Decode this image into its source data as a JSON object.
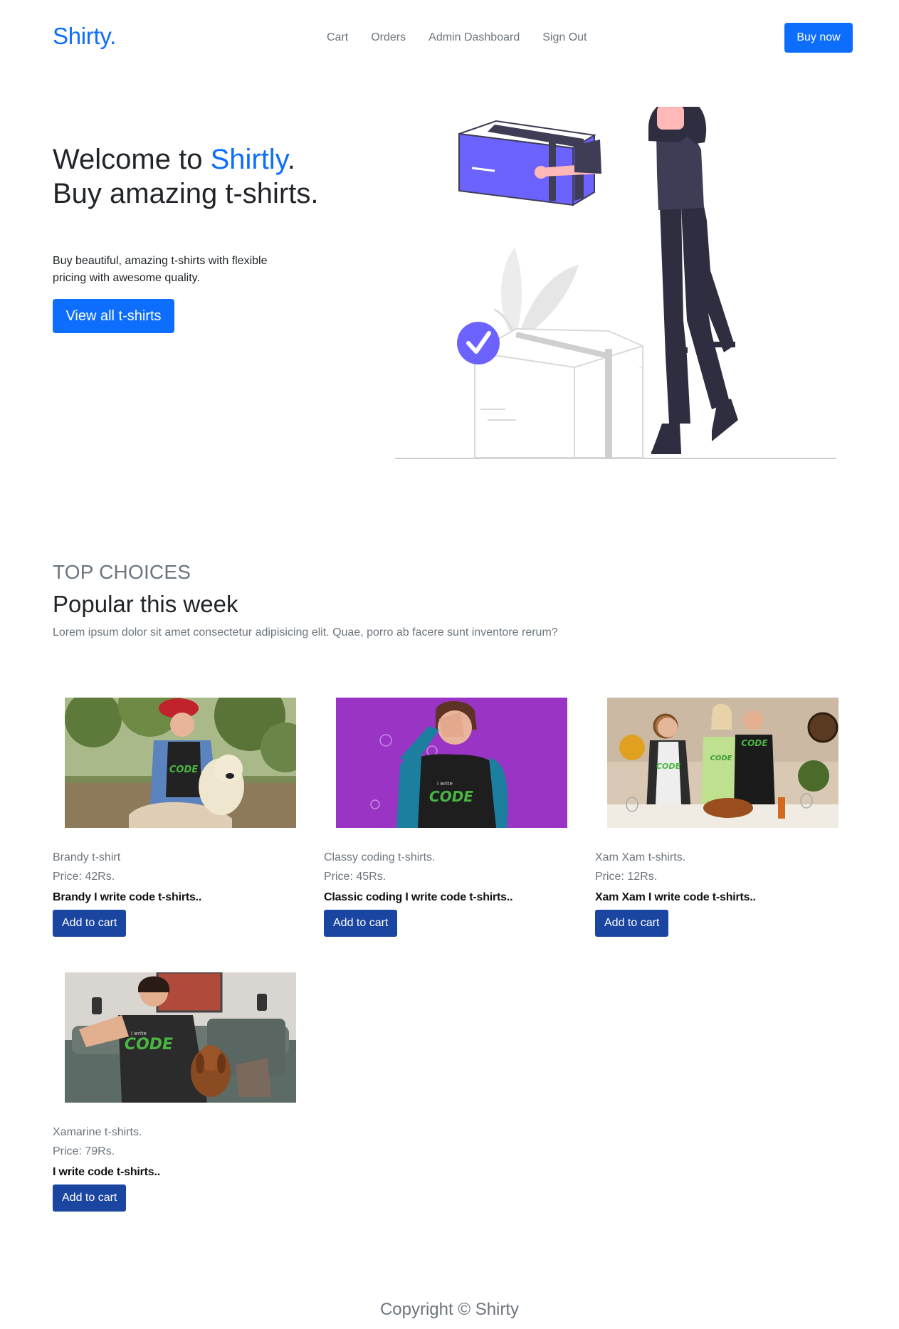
{
  "nav": {
    "brand": "Shirty.",
    "links": [
      "Cart",
      "Orders",
      "Admin Dashboard",
      "Sign Out"
    ],
    "cta": "Buy now"
  },
  "hero": {
    "title_prefix": "Welcome to ",
    "title_accent": "Shirtly",
    "title_suffix": ".",
    "title_line2": "Buy amazing t-shirts.",
    "description": "Buy beautiful, amazing t-shirts with flexible pricing with awesome quality.",
    "button": "View all t-shirts"
  },
  "section": {
    "eyebrow": "TOP CHOICES",
    "title": "Popular this week",
    "description": "Lorem ipsum dolor sit amet consectetur adipisicing elit. Quae, porro ab facere sunt inventore rerum?"
  },
  "products": [
    {
      "name": "Brandy t-shirt",
      "price": "Price: 42Rs.",
      "tagline": "Brandy I write code t-shirts..",
      "button": "Add to cart",
      "image": "woman-with-dog-photo"
    },
    {
      "name": "Classy coding t-shirts.",
      "price": "Price: 45Rs.",
      "tagline": "Classic coding I write code t-shirts..",
      "button": "Add to cart",
      "image": "woman-purple-background-photo"
    },
    {
      "name": "Xam Xam t-shirts.",
      "price": "Price: 12Rs.",
      "tagline": "Xam Xam I write code t-shirts..",
      "button": "Add to cart",
      "image": "family-dinner-photo"
    },
    {
      "name": "Xamarine t-shirts.",
      "price": "Price: 79Rs.",
      "tagline": "I write code t-shirts..",
      "button": "Add to cart",
      "image": "man-with-dog-photo"
    }
  ],
  "shirt_print": "CODE",
  "shirt_print_small": "I write",
  "footer": "Copyright © Shirty",
  "colors": {
    "primary": "#0d6efd",
    "button_dark": "#1a45a0",
    "accent_purple": "#6c63ff",
    "muted": "#6c757d"
  }
}
